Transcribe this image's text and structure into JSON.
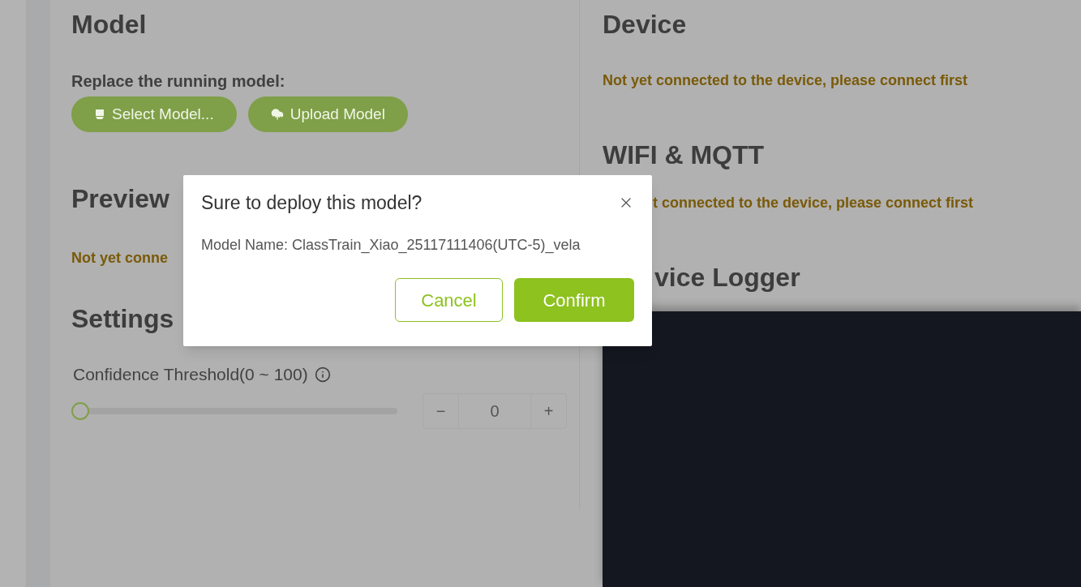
{
  "model": {
    "title": "Model",
    "label": "Replace the running model:",
    "buttons": [
      {
        "label": "Select Model..."
      },
      {
        "label": "Upload Model"
      }
    ]
  },
  "preview": {
    "title": "Preview",
    "message": "Not yet conne"
  },
  "settings": {
    "title": "Settings",
    "threshold_label": "Confidence Threshold(0 ~ 100)",
    "slider": {
      "level": 0
    },
    "stepper": {
      "minus": "−",
      "value": "0",
      "plus": "+"
    }
  },
  "device": {
    "title": "Device",
    "message": "Not yet connected to the device, please connect first"
  },
  "wifi_mqtt": {
    "title": "WIFI & MQTT",
    "message": "t connected to the device, please connect first"
  },
  "device_logger": {
    "title": "vice Logger"
  },
  "dialog": {
    "title": "Sure to deploy this model?",
    "body": "Model Name: ClassTrain_Xiao_25117111406(UTC-5)_vela",
    "buttons": [
      {
        "label": "Cancel",
        "kind": "secondary"
      },
      {
        "label": "Confirm",
        "kind": "primary"
      }
    ]
  }
}
